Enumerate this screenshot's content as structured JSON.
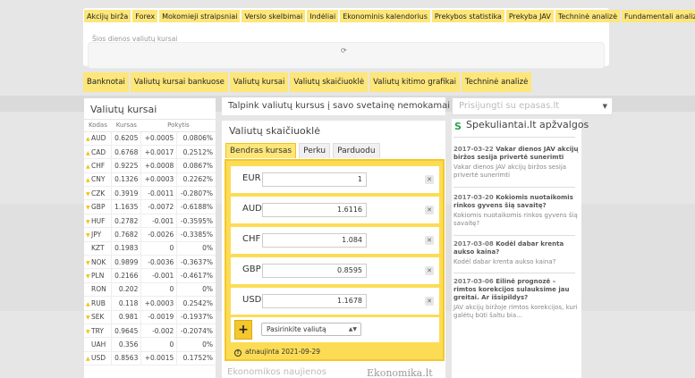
{
  "top_nav": {
    "items": [
      "Akcijų birža",
      "Forex",
      "Mokomieji straipsniai",
      "Verslo skelbimai",
      "Indėliai",
      "Ekonominis kalendorius",
      "Prekybos statistika",
      "Prekyba JAV",
      "Techninė analizė",
      "Fundamentali analizė"
    ],
    "sub_label": "Šios dienos valiutų kursai"
  },
  "sub_nav": {
    "items": [
      "Banknotai",
      "Valiutų kursai bankuose",
      "Valiutų kursai",
      "Valiutų skaičiuoklė",
      "Valiutų kitimo grafikai",
      "Techninė analizė"
    ]
  },
  "rates": {
    "title": "Valiutų kursai",
    "headers": [
      "Kodas",
      "Kursas",
      "Pokytis"
    ],
    "rows": [
      {
        "code": "AUD",
        "dir": "up",
        "rate": "0.6205",
        "change": "+0.0005",
        "pct": "0.0806%"
      },
      {
        "code": "CAD",
        "dir": "up",
        "rate": "0.6768",
        "change": "+0.0017",
        "pct": "0.2512%"
      },
      {
        "code": "CHF",
        "dir": "up",
        "rate": "0.9225",
        "change": "+0.0008",
        "pct": "0.0867%"
      },
      {
        "code": "CNY",
        "dir": "up",
        "rate": "0.1326",
        "change": "+0.0003",
        "pct": "0.2262%"
      },
      {
        "code": "CZK",
        "dir": "down",
        "rate": "0.3919",
        "change": "-0.0011",
        "pct": "-0.2807%"
      },
      {
        "code": "GBP",
        "dir": "down",
        "rate": "1.1635",
        "change": "-0.0072",
        "pct": "-0.6188%"
      },
      {
        "code": "HUF",
        "dir": "down",
        "rate": "0.2782",
        "change": "-0.001",
        "pct": "-0.3595%"
      },
      {
        "code": "JPY",
        "dir": "down",
        "rate": "0.7682",
        "change": "-0.0026",
        "pct": "-0.3385%"
      },
      {
        "code": "KZT",
        "dir": "none",
        "rate": "0.1983",
        "change": "0",
        "pct": "0%"
      },
      {
        "code": "NOK",
        "dir": "down",
        "rate": "0.9899",
        "change": "-0.0036",
        "pct": "-0.3637%"
      },
      {
        "code": "PLN",
        "dir": "down",
        "rate": "0.2166",
        "change": "-0.001",
        "pct": "-0.4617%"
      },
      {
        "code": "RON",
        "dir": "none",
        "rate": "0.202",
        "change": "0",
        "pct": "0%"
      },
      {
        "code": "RUB",
        "dir": "up",
        "rate": "0.118",
        "change": "+0.0003",
        "pct": "0.2542%"
      },
      {
        "code": "SEK",
        "dir": "down",
        "rate": "0.981",
        "change": "-0.0019",
        "pct": "-0.1937%"
      },
      {
        "code": "TRY",
        "dir": "down",
        "rate": "0.9645",
        "change": "-0.002",
        "pct": "-0.2074%"
      },
      {
        "code": "UAH",
        "dir": "none",
        "rate": "0.356",
        "change": "0",
        "pct": "0%"
      },
      {
        "code": "USD",
        "dir": "up",
        "rate": "0.8563",
        "change": "+0.0015",
        "pct": "0.1752%"
      }
    ]
  },
  "promo": "Talpink valiutų kursus į savo svetainę nemokamai",
  "calculator": {
    "title": "Valiutų skaičiuoklė",
    "tabs": [
      "Bendras kursas",
      "Perku",
      "Parduodu"
    ],
    "rows": [
      {
        "code": "EUR",
        "value": "1"
      },
      {
        "code": "AUD",
        "value": "1.6116"
      },
      {
        "code": "CHF",
        "value": "1.084"
      },
      {
        "code": "GBP",
        "value": "0.8595"
      },
      {
        "code": "USD",
        "value": "1.1678"
      }
    ],
    "select_placeholder": "Pasirinkite valiutą",
    "updated": "atnaujinta 2021-09-29",
    "footer_left": "Ekonomikos naujienos",
    "footer_logo": "Ekonomika.lt"
  },
  "login": {
    "placeholder": "Prisijungti su epasas.lt"
  },
  "spekuliantai": {
    "logo": "S",
    "title": "Spekuliantai.lt apžvalgos",
    "news": [
      {
        "date": "2017-03-22",
        "title": "Vakar dienos JAV akcijų biržos sesija privertė sunerimti",
        "desc": "Vakar dienos JAV akcijų biržos sesija privertė sunerimti"
      },
      {
        "date": "2017-03-20",
        "title": "Kokiomis nuotaikomis rinkos gyvens šią savaitę?",
        "desc": "Kokiomis nuotaikomis rinkos gyvens šią savaitę?"
      },
      {
        "date": "2017-03-08",
        "title": "Kodėl dabar krenta aukso kaina?",
        "desc": "Kodėl dabar krenta aukso kaina?"
      },
      {
        "date": "2017-03-06",
        "title": "Eilinė prognozė – rimtos korekcijos sulauksime jau greitai. Ar išsipildys?",
        "desc": "JAV akcijų biržoje rimtos korekcijos, kuri galėtų būti šaltu bia..."
      }
    ]
  }
}
